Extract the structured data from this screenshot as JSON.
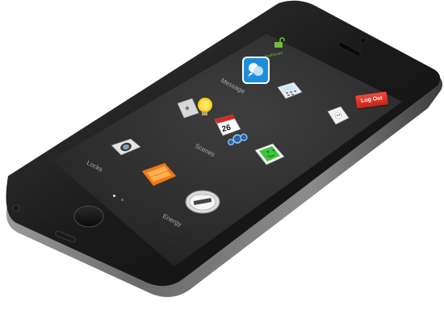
{
  "header": {
    "status_caption": "Dashboard",
    "logout_label": "Log Out"
  },
  "apps": [
    {
      "id": "message",
      "label": "Message",
      "icon": "message-icon"
    },
    {
      "id": "climate",
      "label": "",
      "icon": "thermostat-icon"
    },
    {
      "id": "lights",
      "label": "",
      "icon": "lightbulb-icon"
    },
    {
      "id": "scenes",
      "label": "Scenes",
      "icon": "calendar-icon",
      "badge": "26"
    },
    {
      "id": "camera",
      "label": "",
      "icon": "camera-icon"
    },
    {
      "id": "locks",
      "label": "Locks",
      "icon": "lock-icon"
    },
    {
      "id": "blinds",
      "label": "",
      "icon": "blinds-icon"
    },
    {
      "id": "outlets",
      "label": "",
      "icon": "outlet-icon"
    },
    {
      "id": "energy",
      "label": "Energy",
      "icon": "energy-meter-icon"
    }
  ],
  "pager": {
    "current": 1,
    "total": 2
  },
  "colors": {
    "accent_green": "#6fbf3a",
    "logout_red": "#d9302a",
    "screen_bg": "#2e2e2e"
  }
}
